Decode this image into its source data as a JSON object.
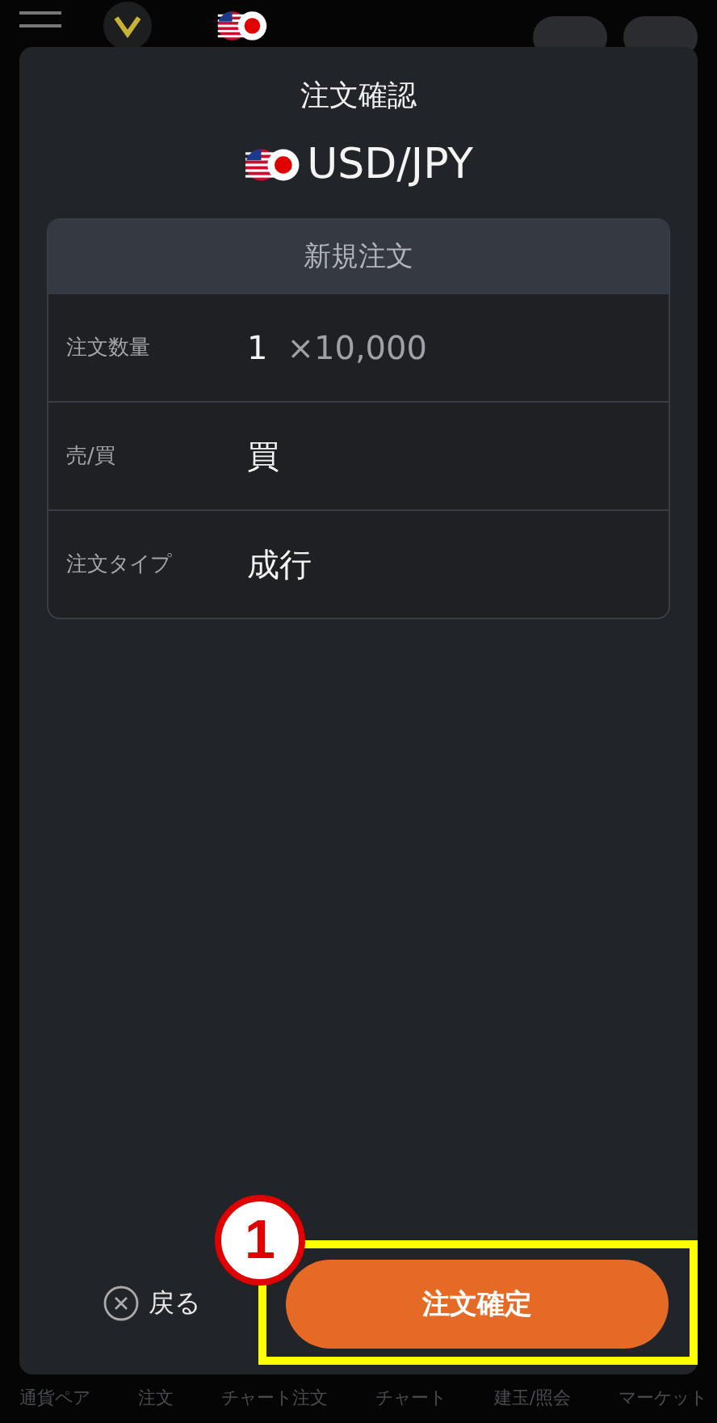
{
  "dialog": {
    "title": "注文確認",
    "pair": "USD/JPY",
    "table": {
      "heading": "新規注文",
      "rows": [
        {
          "kind": "quantity",
          "label": "注文数量",
          "value": "1",
          "unit": "×10,000"
        },
        {
          "kind": "plain",
          "label": "売/買",
          "value": "買"
        },
        {
          "kind": "plain",
          "label": "注文タイプ",
          "value": "成行"
        }
      ]
    },
    "back_button": "戻る",
    "confirm_button": "注文確定"
  },
  "annotation": {
    "label": "1"
  },
  "bottom_nav": [
    "通貨ペア",
    "注文",
    "チャート注文",
    "チャート",
    "建玉/照会",
    "マーケット"
  ]
}
